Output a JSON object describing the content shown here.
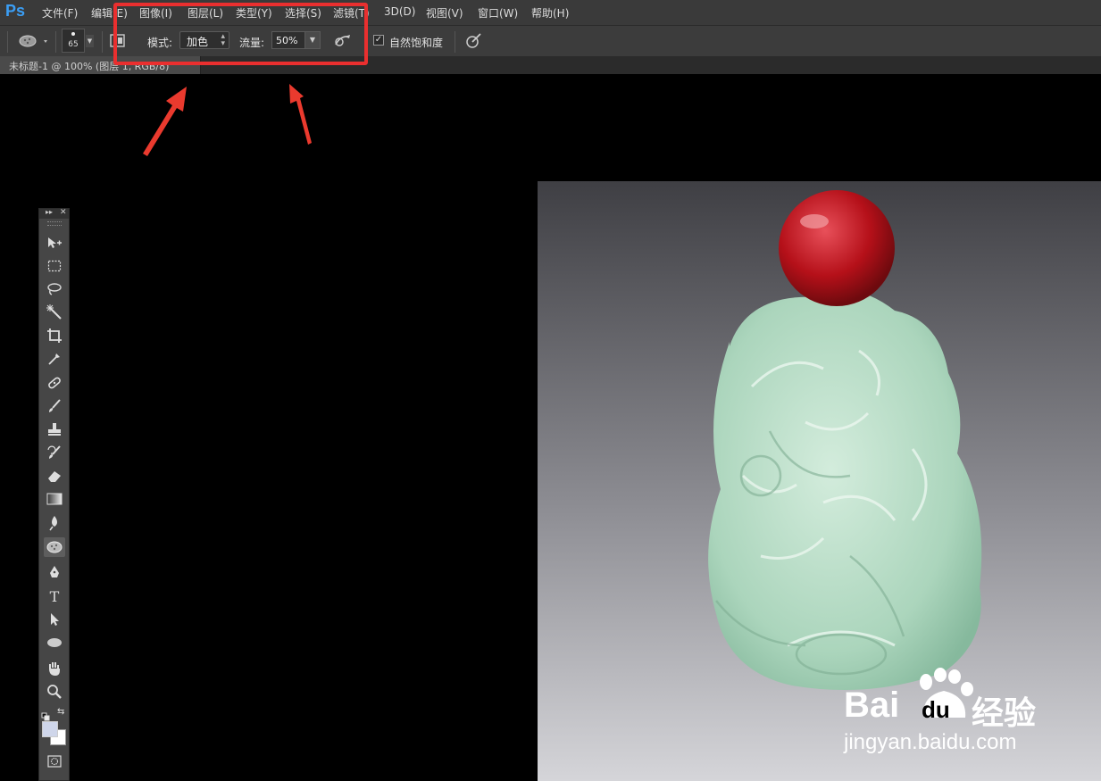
{
  "app": {
    "logo": "Ps"
  },
  "menu": [
    "文件(F)",
    "编辑(E)",
    "图像(I)",
    "图层(L)",
    "类型(Y)",
    "选择(S)",
    "滤镜(T)",
    "3D(D)",
    "视图(V)",
    "窗口(W)",
    "帮助(H)"
  ],
  "options": {
    "brush_size": "65",
    "mode_label": "模式:",
    "mode_value": "加色",
    "flow_label": "流量:",
    "flow_value": "50%",
    "vibrance_label": "自然饱和度",
    "vibrance_checked": true
  },
  "document_tab": {
    "title": "未标题-1 @ 100% (图层 1, RGB/8)"
  },
  "tools": [
    "move-tool",
    "marquee-tool",
    "lasso-tool",
    "magic-wand-tool",
    "crop-tool",
    "eyedropper-tool",
    "healing-brush-tool",
    "brush-tool",
    "clone-stamp-tool",
    "history-brush-tool",
    "eraser-tool",
    "gradient-tool",
    "blur-tool",
    "sponge-tool",
    "pen-tool",
    "type-tool",
    "path-selection-tool",
    "ellipse-tool",
    "hand-tool",
    "zoom-tool"
  ],
  "watermark": {
    "brand": "Bai",
    "brand_suffix": "du",
    "product": "经验",
    "url": "jingyan.baidu.com"
  },
  "colors": {
    "highlight": "#ea2f2f",
    "accent": "#3b9ef5",
    "jade": "#b9ddc6",
    "bead": "#c0141a"
  }
}
